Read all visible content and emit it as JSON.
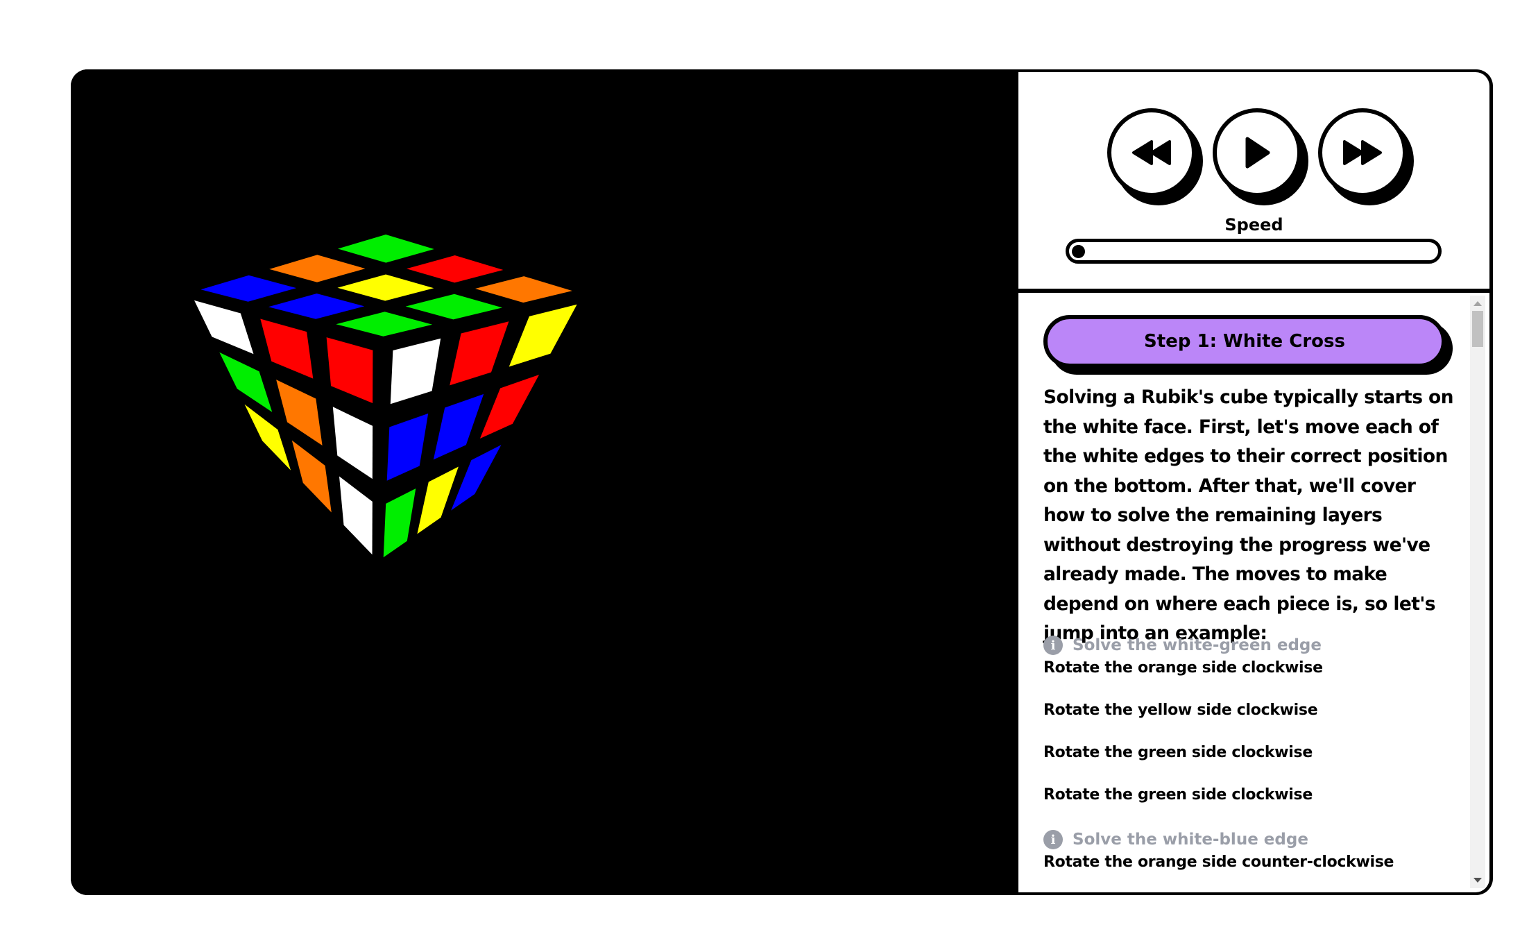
{
  "controls": {
    "rewind_icon": "rewind-icon",
    "play_icon": "play-icon",
    "fast_forward_icon": "fast-forward-icon",
    "speed_label": "Speed",
    "speed_value": 0
  },
  "step": {
    "title": "Step 1: White Cross",
    "intro": "Solving a Rubik's cube typically starts on the white face. First, let's move each of the white edges to their correct position on the bottom. After that, we'll cover how to solve the remaining layers without destroying the progress we've already made. The moves to make depend on where each piece is, so let's jump into an example:",
    "sections": [
      {
        "heading": "Solve the white-green edge",
        "moves": [
          "Rotate the orange side clockwise",
          "Rotate the yellow side clockwise",
          "Rotate the green side clockwise",
          "Rotate the green side clockwise"
        ]
      },
      {
        "heading": "Solve the white-blue edge",
        "moves": [
          "Rotate the orange side counter-clockwise"
        ]
      }
    ]
  },
  "colors": {
    "white": "#ffffff",
    "yellow": "#ffff00",
    "red": "#ff0000",
    "orange": "#ff7700",
    "blue": "#0000ff",
    "green": "#00ee00",
    "step_header": "#bb86f8",
    "hint_gray": "#9a9ea8"
  },
  "cube": {
    "top_face": [
      [
        "green",
        "red",
        "orange"
      ],
      [
        "orange",
        "yellow",
        "green"
      ],
      [
        "blue",
        "blue",
        "green"
      ]
    ],
    "left_face": [
      [
        "white",
        "red",
        "red"
      ],
      [
        "green",
        "orange",
        "white"
      ],
      [
        "yellow",
        "orange",
        "white"
      ]
    ],
    "right_face": [
      [
        "white",
        "red",
        "yellow"
      ],
      [
        "blue",
        "blue",
        "red"
      ],
      [
        "green",
        "yellow",
        "blue"
      ]
    ]
  }
}
